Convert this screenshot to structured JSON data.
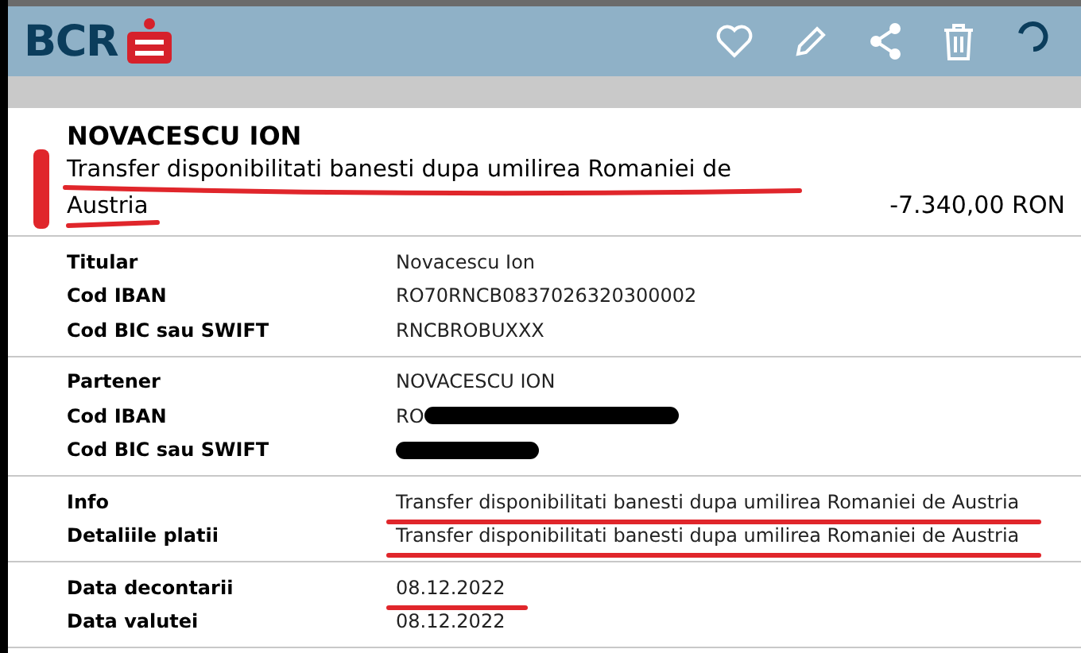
{
  "header": {
    "logo": "BCR"
  },
  "transaction": {
    "name": "NOVACESCU ION",
    "description": "Transfer disponibilitati banesti dupa umilirea Romaniei de Austria",
    "description_marked": true,
    "amount": "-7.340,00 RON"
  },
  "sections": [
    {
      "rows": [
        {
          "label": "Titular",
          "value": "Novacescu Ion",
          "marked": false,
          "redacted": false
        },
        {
          "label": "Cod IBAN",
          "value": "RO70RNCB0837026320300002",
          "marked": false,
          "redacted": false
        },
        {
          "label": "Cod BIC sau SWIFT",
          "value": "RNCBROBUXXX",
          "marked": false,
          "redacted": false
        }
      ]
    },
    {
      "rows": [
        {
          "label": "Partener",
          "value": "NOVACESCU ION",
          "marked": false,
          "redacted": false
        },
        {
          "label": "Cod IBAN",
          "value": "RO",
          "marked": false,
          "redacted": true
        },
        {
          "label": "Cod BIC sau SWIFT",
          "marked": false,
          "redacted": true
        }
      ]
    },
    {
      "rows": [
        {
          "label": "Info",
          "value": "Transfer disponibilitati banesti dupa umilirea Romaniei de Austria",
          "marked": true,
          "redacted": false
        },
        {
          "label": "Detaliile platii",
          "value": "Transfer disponibilitati banesti dupa umilirea Romaniei de Austria",
          "marked": true,
          "redacted": false
        }
      ]
    },
    {
      "rows": [
        {
          "label": "Data decontarii",
          "value": "08.12.2022",
          "marked": true,
          "redacted": false
        },
        {
          "label": "Data valutei",
          "value": "08.12.2022",
          "marked": false,
          "redacted": false
        }
      ]
    }
  ]
}
